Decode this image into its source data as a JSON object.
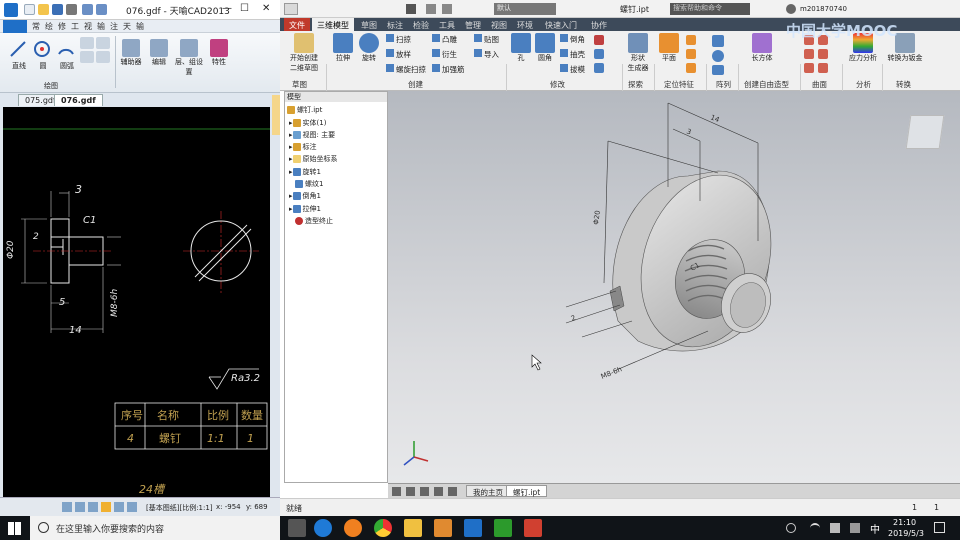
{
  "cad": {
    "title": "076.gdf - 天喻CAD2013",
    "menu_tabs": [
      "常",
      "绘",
      "修",
      "工",
      "视",
      "输",
      "注",
      "天",
      "输"
    ],
    "ribbon": {
      "tools": [
        "直线",
        "圆",
        "圆弧"
      ],
      "group_label": "绘图",
      "panels": [
        "辅助器",
        "编辑",
        "层、组设置",
        "特性"
      ]
    },
    "file_tabs": [
      "075.gdf",
      "076.gdf"
    ],
    "drawing": {
      "dims": [
        "3",
        "C1",
        "Φ20",
        "2",
        "5",
        "M8-6h",
        "14"
      ],
      "roughness": "Ra3.2",
      "table_headers": [
        "序号",
        "名称",
        "比例",
        "数量"
      ],
      "table_row": [
        "4",
        "螺钉",
        "1:1",
        "1"
      ],
      "bottom_text": "24槽"
    },
    "status": {
      "layout": "[基本图纸][比例:1:1]",
      "x": "x: -954",
      "y": "y: 689"
    }
  },
  "inv": {
    "title_search": "搜索帮助和命令",
    "doc_name": "螺钉.ipt",
    "user": "m201870740",
    "dropdown_value": "默认",
    "tabs": [
      "文件",
      "三维模型",
      "草图",
      "标注",
      "检验",
      "工具",
      "管理",
      "视图",
      "环境",
      "快速入门",
      "协作"
    ],
    "active_tab": "三维模型",
    "ribbon": {
      "sketch": [
        "开始创建",
        "二维草图"
      ],
      "create_big": [
        "拉伸",
        "旋转"
      ],
      "create_small": [
        "扫掠",
        "放样",
        "螺旋扫掠",
        "凸雕",
        "衍生",
        "加强筋",
        "贴图",
        "导入"
      ],
      "modify": [
        "孔",
        "圆角",
        "倒角",
        "抽壳",
        "拔模"
      ],
      "explore": [
        "形状",
        "生成器"
      ],
      "plane": "平面",
      "freeform": "长方体",
      "analysis": "应力分析",
      "convert": "转换为钣金",
      "groups": [
        "草图",
        "创建",
        "修改",
        "探索",
        "定位特征",
        "阵列",
        "创建自由造型",
        "曲面",
        "分析",
        "转换"
      ]
    },
    "browser": {
      "header": "模型",
      "items": [
        "螺钉.ipt",
        "实体(1)",
        "视图: 主要",
        "标注",
        "原始坐标系",
        "旋转1",
        "螺纹1",
        "倒角1",
        "拉伸1",
        "造型终止"
      ]
    },
    "viewport_dims": [
      "14",
      "3",
      "Φ20",
      "2",
      "C1",
      "M8-6h"
    ],
    "doc_tabs": [
      "我的主页",
      "螺钉.ipt"
    ],
    "status_left": "就绪",
    "status_right": [
      "1",
      "1"
    ],
    "watermark": "中国大学MOOC"
  },
  "taskbar": {
    "search_placeholder": "在这里输入你要搜索的内容",
    "time": "21:10",
    "date": "2019/5/3",
    "ime": "中"
  }
}
